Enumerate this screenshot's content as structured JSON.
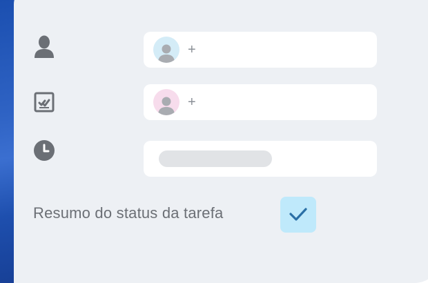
{
  "assignee": {
    "icon": "user-icon",
    "field_icon": "avatar-placeholder-icon",
    "add_label": "+",
    "avatar_color": "#d4ecf7"
  },
  "reviewer": {
    "icon": "task-checklist-icon",
    "field_icon": "avatar-placeholder-icon",
    "add_label": "+",
    "avatar_color": "#f7dcec"
  },
  "due_time": {
    "icon": "clock-icon"
  },
  "status_summary": {
    "label": "Resumo do status da tarefa",
    "checked": true,
    "checkbox_color": "#bfe9fb"
  },
  "colors": {
    "accent_blue": "#1b4fb0",
    "card_background": "#edf0f4",
    "icon_gray": "#6b6f75",
    "check_mark": "#2a6fa6"
  }
}
